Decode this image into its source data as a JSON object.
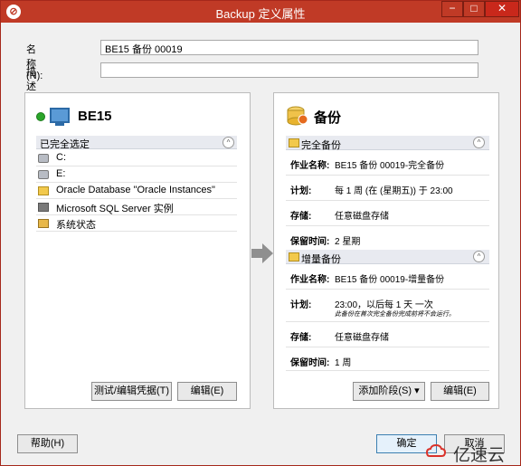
{
  "window": {
    "title": "Backup 定义属性",
    "min_glyph": "−",
    "max_glyph": "□",
    "close_glyph": "✕"
  },
  "form": {
    "name_label": "名称(N):",
    "name_value": "BE15 备份 00019",
    "desc_label": "描述(D):",
    "desc_value": ""
  },
  "left_panel": {
    "server_name": "BE15",
    "section_title": "已完全选定",
    "collapse_glyph": "^",
    "selections": [
      {
        "label": "C:",
        "icon": "drive-icon"
      },
      {
        "label": "E:",
        "icon": "drive-icon"
      },
      {
        "label": "Oracle Database \"Oracle Instances\"",
        "icon": "oracle-icon"
      },
      {
        "label": "Microsoft SQL Server 实例",
        "icon": "sql-server-icon"
      },
      {
        "label": "系统状态",
        "icon": "system-state-icon"
      }
    ],
    "test_button": "测试/编辑凭据(T)",
    "edit_button": "编辑(E)"
  },
  "right_panel": {
    "title": "备份",
    "collapse_glyph": "^",
    "stages": [
      {
        "name": "完全备份",
        "rows": [
          {
            "key": "作业名称:",
            "value": "BE15 备份 00019-完全备份"
          },
          {
            "key": "计划:",
            "value": "每 1 周 (在 (星期五)) 于 23:00"
          },
          {
            "key": "存储:",
            "value": "任意磁盘存储"
          },
          {
            "key": "保留时间:",
            "value": "2 星期"
          }
        ]
      },
      {
        "name": "增量备份",
        "rows": [
          {
            "key": "作业名称:",
            "value": "BE15 备份 00019-增量备份"
          },
          {
            "key": "计划:",
            "value": "23:00，以后每 1 天 一次",
            "note": "此备份在首次完全备份完成前将不会运行。"
          },
          {
            "key": "存储:",
            "value": "任意磁盘存储"
          },
          {
            "key": "保留时间:",
            "value": "1 周"
          }
        ]
      }
    ],
    "add_stage_button": "添加阶段(S) ▾",
    "edit_button": "编辑(E)"
  },
  "footer": {
    "help_button": "帮助(H)",
    "ok_button": "确定",
    "cancel_button": "取消"
  },
  "watermark": {
    "text": "亿速云"
  },
  "colors": {
    "titlebar": "#c03a26",
    "accent": "#3c7fb1"
  }
}
